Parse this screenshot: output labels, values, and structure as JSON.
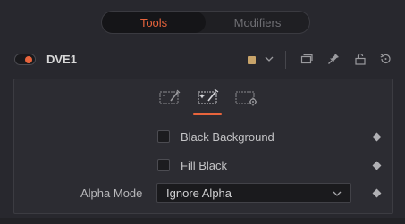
{
  "tabs": [
    {
      "label": "Tools",
      "active": true
    },
    {
      "label": "Modifiers",
      "active": false
    }
  ],
  "header": {
    "tool_name": "DVE1",
    "enabled": true,
    "swatch_color": "#c8a46a",
    "icons": [
      "chevron-down-icon",
      "version-icon",
      "pin-icon",
      "lock-icon",
      "reset-icon"
    ]
  },
  "subtabs": [
    {
      "icon": "controls-icon",
      "active": false
    },
    {
      "icon": "settings-wand-icon",
      "active": true
    },
    {
      "icon": "gear-settings-icon",
      "active": false
    }
  ],
  "controls": {
    "black_background": {
      "label": "Black Background",
      "checked": false
    },
    "fill_black": {
      "label": "Fill Black",
      "checked": false
    },
    "alpha_mode": {
      "label": "Alpha Mode",
      "value": "Ignore Alpha"
    }
  },
  "colors": {
    "accent": "#e8643c",
    "background": "#28282e",
    "panel": "#2c2c32"
  }
}
